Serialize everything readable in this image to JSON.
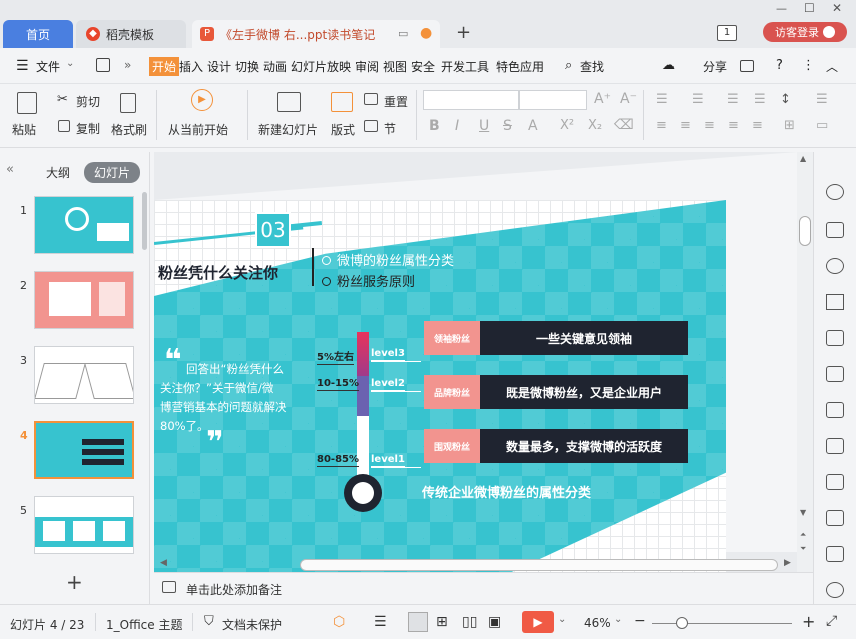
{
  "tabs": {
    "home": "首页",
    "daoke": "稻壳模板",
    "doc": "《左手微博 右...ppt读书笔记",
    "new_tab": "+"
  },
  "window": {
    "count": "1",
    "login": "访客登录"
  },
  "menu": {
    "file": "文件",
    "items": [
      "开始",
      "插入",
      "设计",
      "切换",
      "动画",
      "幻灯片放映",
      "审阅",
      "视图",
      "安全",
      "开发工具",
      "特色应用"
    ],
    "search": "查找",
    "share": "分享"
  },
  "ribbon": {
    "paste": "粘贴",
    "cut": "剪切",
    "copy": "复制",
    "format_painter": "格式刷",
    "from_current": "从当前开始",
    "new_slide": "新建幻灯片",
    "layout": "版式",
    "reset": "重置",
    "section": "节"
  },
  "panel": {
    "outline": "大纲",
    "slides": "幻灯片",
    "numbers": [
      "1",
      "2",
      "3",
      "4",
      "5"
    ],
    "add": "+"
  },
  "slide": {
    "number": "03",
    "title": "粉丝凭什么关注你",
    "bullets": [
      "微博的粉丝属性分类",
      "粉丝服务原则"
    ],
    "quote": [
      "回答出“粉丝凭什么",
      "关注你？”关于微信/微",
      "博营销基本的问题就解决",
      "80%了。"
    ],
    "percent_labels": [
      "5%左右",
      "10-15%",
      "80-85%"
    ],
    "level_labels": [
      "level3",
      "level2",
      "level1"
    ],
    "categories": [
      "领袖粉丝",
      "品牌粉丝",
      "围观粉丝"
    ],
    "descriptions": [
      "一些关键意见领袖",
      "既是微博粉丝，又是企业用户",
      "数量最多，支撑微博的活跃度"
    ],
    "caption": "传统企业微博粉丝的属性分类"
  },
  "notes": {
    "placeholder": "单击此处添加备注"
  },
  "status": {
    "slide_count": "幻灯片 4 / 23",
    "theme": "1_Office 主题",
    "protect": "文档未保护",
    "zoom": "46%"
  },
  "colors": {
    "accent": "#f3913a",
    "teal": "#37c3cf",
    "pink": "#f2948f",
    "dark": "#1f2430",
    "play": "#f05a45"
  }
}
